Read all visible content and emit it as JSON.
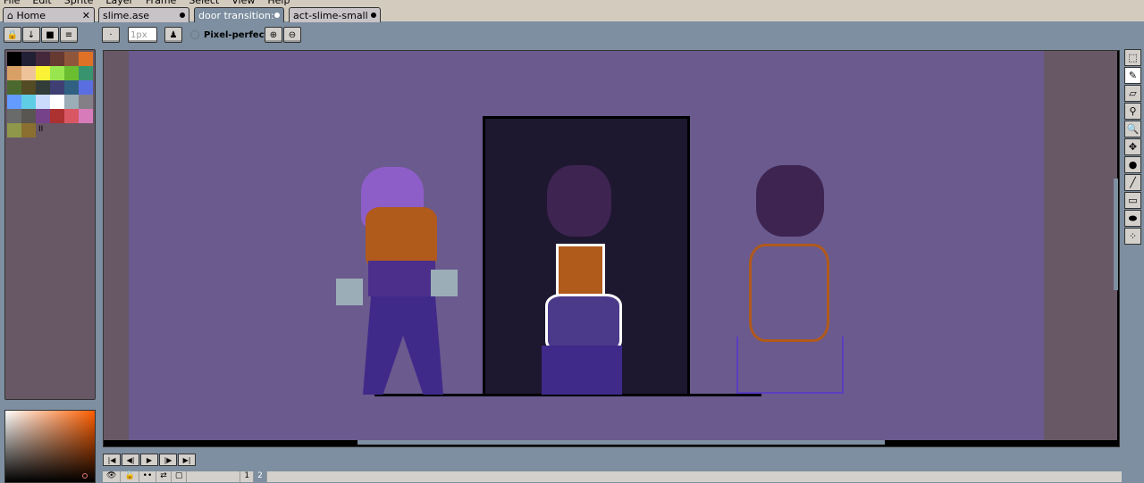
{
  "menu": [
    "File",
    "Edit",
    "Sprite",
    "Layer",
    "Frame",
    "Select",
    "View",
    "Help"
  ],
  "tabs": [
    {
      "label": "Home",
      "icon": "home-icon",
      "close": "✕"
    },
    {
      "label": "slime.ase"
    },
    {
      "label": "door transition:",
      "active": true
    },
    {
      "label": "act-slime-small"
    }
  ],
  "toolbar": {
    "brush_size": "1px",
    "pixel_perfect": "Pixel-perfect"
  },
  "palette": [
    "#000000",
    "#222034",
    "#45283c",
    "#663931",
    "#8f563b",
    "#df7126",
    "#d9a066",
    "#eec39a",
    "#fbf236",
    "#99e550",
    "#6abe30",
    "#37946e",
    "#4b692f",
    "#524b24",
    "#323c39",
    "#3f3f74",
    "#306082",
    "#5b6ee1",
    "#639bff",
    "#5fcde4",
    "#cbdbfc",
    "#ffffff",
    "#9badb7",
    "#847e87",
    "#696a6a",
    "#595652",
    "#76428a",
    "#ac3232",
    "#d95763",
    "#d77bba",
    "#8f974a",
    "#8a6f30"
  ],
  "timeline": {
    "frames": [
      "1",
      "2"
    ]
  },
  "colors": {
    "canvas": "#6a5a8e",
    "door": "#1d1730",
    "side": "#685866"
  }
}
